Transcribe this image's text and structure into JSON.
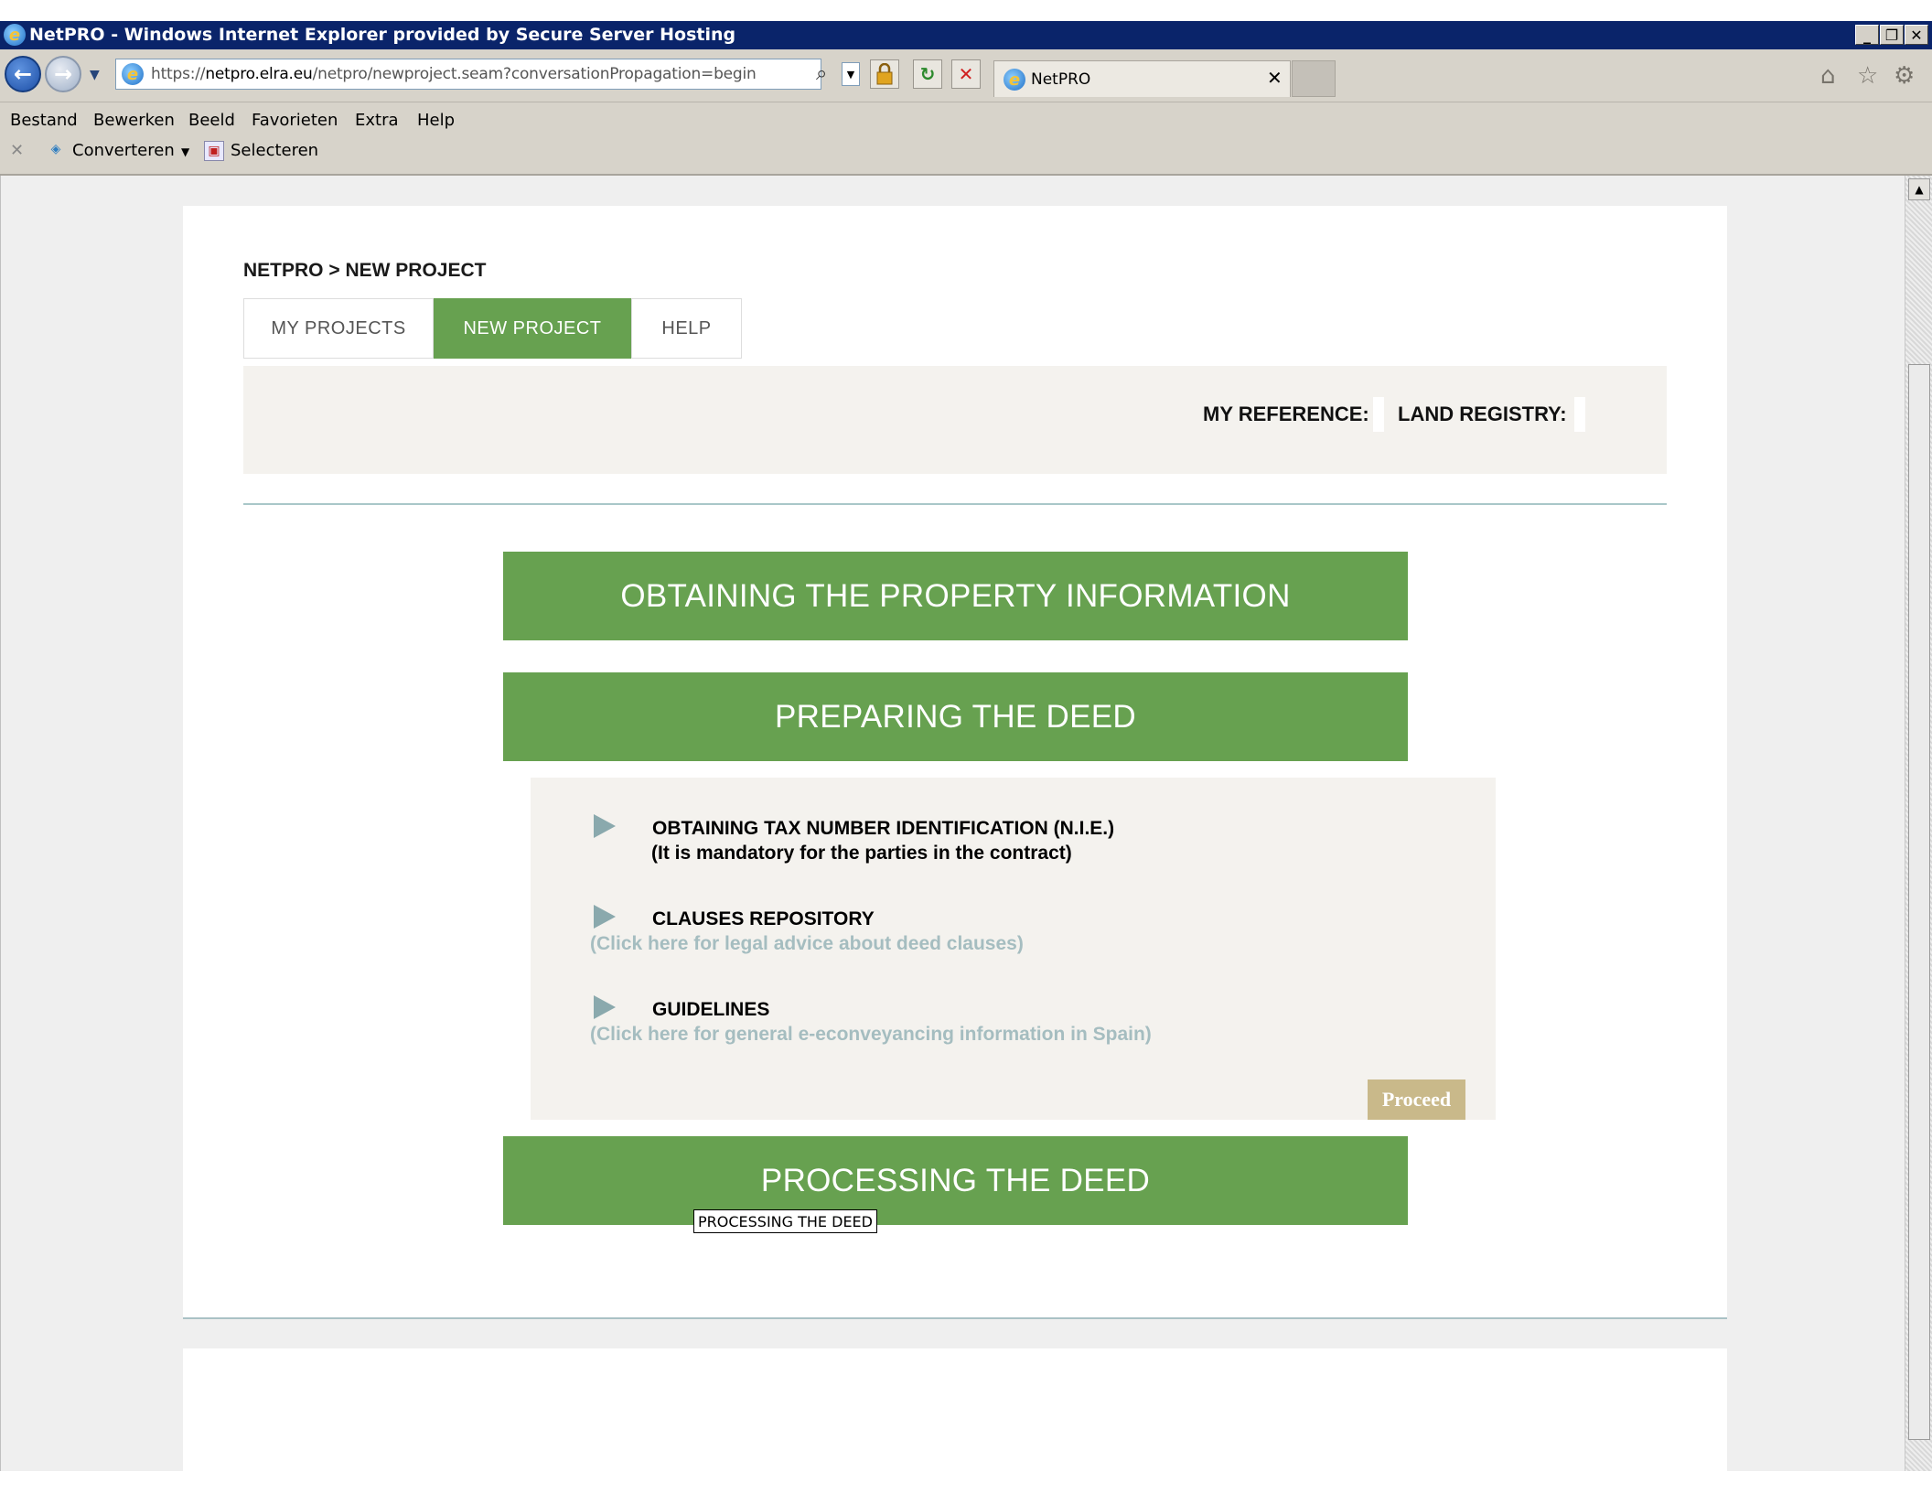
{
  "window": {
    "title": "NetPRO - Windows Internet Explorer provided by Secure Server Hosting"
  },
  "browser": {
    "url_prefix": "https://",
    "url_host": "netpro.elra.eu",
    "url_path": "/netpro/newproject.seam?conversationPropagation=begin",
    "tab_title": "NetPRO",
    "menu": [
      "Bestand",
      "Bewerken",
      "Beeld",
      "Favorieten",
      "Extra",
      "Help"
    ],
    "commands": {
      "convert_label": "Converteren",
      "select_label": "Selecteren"
    }
  },
  "page": {
    "breadcrumb": "NETPRO > NEW PROJECT",
    "tabs": [
      {
        "label": "MY PROJECTS",
        "active": false
      },
      {
        "label": "NEW PROJECT",
        "active": true
      },
      {
        "label": "HELP",
        "active": false
      }
    ],
    "reference": {
      "my_reference_label": "MY REFERENCE:",
      "my_reference_value": "",
      "land_registry_label": "LAND REGISTRY:",
      "land_registry_value": ""
    },
    "sections": [
      {
        "label": "OBTAINING THE PROPERTY INFORMATION"
      },
      {
        "label": "PREPARING THE DEED"
      },
      {
        "label": "PROCESSING THE DEED"
      }
    ],
    "deed_items": [
      {
        "title": "OBTAINING TAX NUMBER IDENTIFICATION (N.I.E.)",
        "subtitle": "(It is mandatory for the parties in the contract)"
      },
      {
        "title": "CLAUSES REPOSITORY",
        "link": "(Click here for legal advice about deed clauses)"
      },
      {
        "title": "GUIDELINES",
        "link": "(Click here for general e-econveyancing information in Spain)"
      }
    ],
    "proceed_label": "Proceed",
    "tooltip": "PROCESSING THE DEED"
  },
  "colors": {
    "accent_green": "#67a150",
    "link_muted": "#a5bdc0",
    "proceed": "#c9b98a",
    "titlebar": "#0a246a"
  },
  "icons": [
    "ie-icon",
    "back-icon",
    "forward-icon",
    "search-icon",
    "lock-icon",
    "refresh-icon",
    "stop-icon",
    "home-icon",
    "star-icon",
    "gear-icon",
    "play-icon"
  ]
}
